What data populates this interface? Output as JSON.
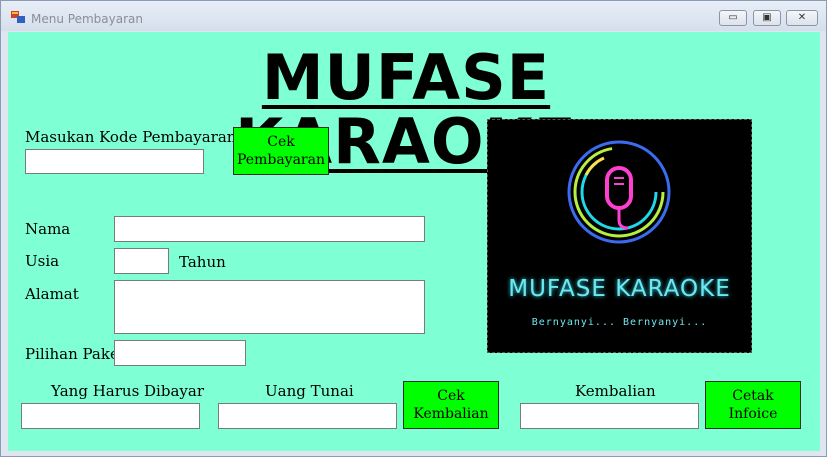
{
  "window": {
    "title": "Menu Pembayaran",
    "minimize": "▭",
    "maximize": "▣",
    "close": "✕"
  },
  "header": {
    "title": "MUFASE KARAOKE"
  },
  "payment": {
    "code_label": "Masukan Kode Pembayaran",
    "code_value": "",
    "check_button": "Cek Pembayaran"
  },
  "customer": {
    "name_label": "Nama",
    "name_value": "",
    "age_label": "Usia",
    "age_value": "",
    "age_unit": "Tahun",
    "address_label": "Alamat",
    "address_value": "",
    "package_label": "Pilihan Paket",
    "package_value": ""
  },
  "billing": {
    "due_label": "Yang Harus Dibayar",
    "due_value": "",
    "cash_label": "Uang Tunai",
    "cash_value": "",
    "check_change_button": "Cek Kembalian",
    "change_label": "Kembalian",
    "change_value": "",
    "print_button": "Cetak Infoice"
  },
  "logo": {
    "title": "MUFASE KARAOKE",
    "tagline": "Bernyanyi... Bernyanyi..."
  }
}
